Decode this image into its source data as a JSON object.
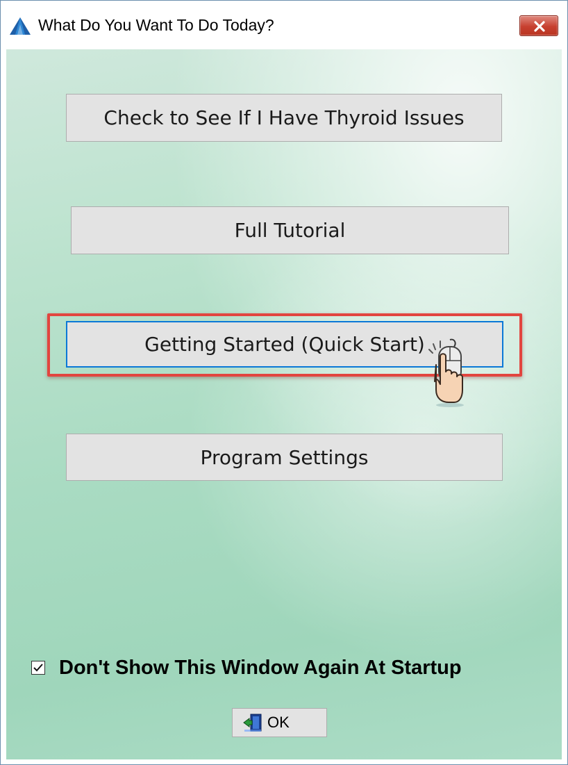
{
  "window": {
    "title": "What Do You Want To Do Today?"
  },
  "buttons": {
    "check_thyroid": "Check to See If I Have Thyroid Issues",
    "full_tutorial": "Full Tutorial",
    "getting_started": "Getting Started (Quick Start)",
    "program_settings": "Program Settings"
  },
  "footer": {
    "dont_show_label": "Don't Show This Window Again At Startup",
    "dont_show_checked": true,
    "ok_label": "OK"
  },
  "colors": {
    "highlight": "#e2453f",
    "focus_border": "#0a78d7",
    "close_button": "#c7402f"
  },
  "icons": {
    "app": "app-triangle-icon",
    "close": "close-icon",
    "cursor": "hand-pointer-cursor-icon",
    "ok": "exit-door-icon"
  }
}
